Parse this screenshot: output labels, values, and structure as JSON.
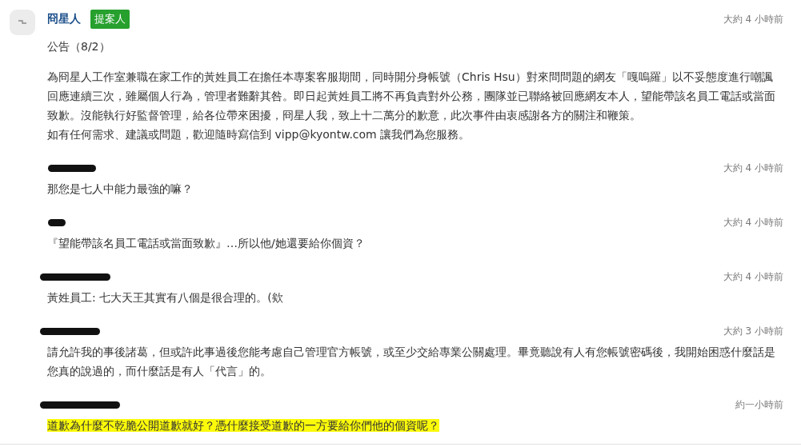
{
  "post": {
    "author": "冏星人",
    "badge": "提案人",
    "time": "大約 4 小時前",
    "title": "公告（8/2）",
    "paragraphs": [
      "為冏星人工作室兼職在家工作的黃姓員工在擔任本專案客服期間，同時開分身帳號（Chris Hsu）對來問問題的網友「嘎嗚羅」以不妥態度進行嘲諷回應連續三次，雖屬個人行為，管理者難辭其咎。即日起黃姓員工將不再負責對外公務，團隊並已聯絡被回應網友本人，望能帶該名員工電話或當面致歉。沒能執行好監督管理，給各位帶來困擾，冏星人我，致上十二萬分的歉意，此次事件由衷感謝各方的關注和鞭策。",
      "如有任何需求、建議或問題，歡迎隨時寫信到 vipp@kyontw.com 讓我們為您服務。"
    ]
  },
  "comments": [
    {
      "author_redacted": true,
      "time": "大約 4 小時前",
      "text": "那您是七人中能力最強的嘛？",
      "highlighted": false
    },
    {
      "author_redacted": true,
      "time": "大約 4 小時前",
      "text": "『望能帶該名員工電話或當面致歉』…所以他/她還要給你個資？",
      "highlighted": false
    },
    {
      "author_redacted": true,
      "time": "大約 4 小時前",
      "text": "黃姓員工: 七大天王其實有八個是很合理的。(欸",
      "highlighted": false
    },
    {
      "author_redacted": true,
      "time": "大約 3 小時前",
      "text": "請允許我的事後諸葛，但或許此事過後您能考慮自己管理官方帳號，或至少交給專業公關處理。畢竟聽說有人有您帳號密碼後，我開始困惑什麼話是您真的說過的，而什麼話是有人「代言」的。",
      "highlighted": false
    },
    {
      "author_redacted": true,
      "time": "約一小時前",
      "text": "道歉為什麼不乾脆公開道歉就好？憑什麼接受道歉的一方要給你們他的個資呢？",
      "highlighted": true
    }
  ]
}
